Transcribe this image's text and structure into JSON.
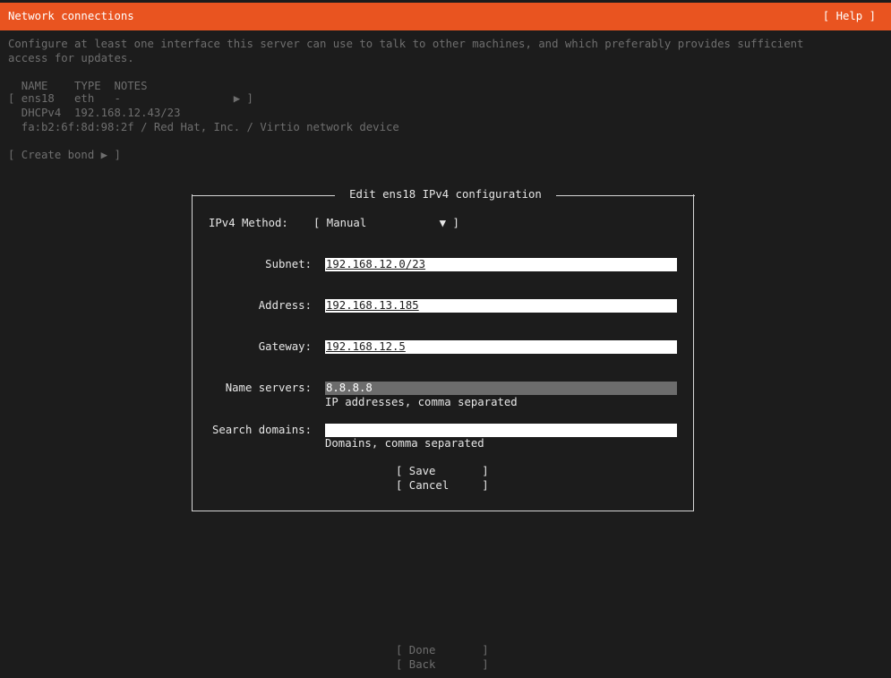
{
  "header": {
    "title": "Network connections",
    "help_button": "[ Help ]"
  },
  "intro_text_line1": "Configure at least one interface this server can use to talk to other machines, and which preferably provides sufficient",
  "intro_text_line2": "access for updates.",
  "interfaces_table": {
    "columns": [
      "NAME",
      "TYPE",
      "NOTES"
    ],
    "header_line": "  NAME    TYPE  NOTES",
    "row_line": "[ ens18   eth   -                 ▶ ]",
    "rows": [
      {
        "name": "ens18",
        "type": "eth",
        "notes": "-"
      }
    ],
    "detail_line1": "  DHCPv4  192.168.12.43/23",
    "detail_line2": "  fa:b2:6f:8d:98:2f / Red Hat, Inc. / Virtio network device"
  },
  "create_bond_button": "[ Create bond ▶ ]",
  "dialog": {
    "title": " Edit ens18 IPv4 configuration ",
    "method_label": "IPv4 Method:",
    "method_value": "[ Manual           ▼ ]",
    "subnet_label": "Subnet:",
    "subnet_value": "192.168.12.0/23",
    "address_label": "Address:",
    "address_value": "192.168.13.185",
    "gateway_label": "Gateway:",
    "gateway_value": "192.168.12.5",
    "nameservers_label": "Name servers:",
    "nameservers_value": "8.8.8.8",
    "nameservers_help": "IP addresses, comma separated",
    "searchdomains_label": "Search domains:",
    "searchdomains_value": "",
    "searchdomains_help": "Domains, comma separated",
    "save_button": "[ Save       ]",
    "cancel_button": "[ Cancel     ]"
  },
  "footer": {
    "done_button": "[ Done       ]",
    "back_button": "[ Back       ]"
  },
  "colors": {
    "accent": "#e95420",
    "background": "#1c1c1c",
    "field_bg": "#ffffff",
    "focused_field_bg": "#6c6c6c"
  }
}
